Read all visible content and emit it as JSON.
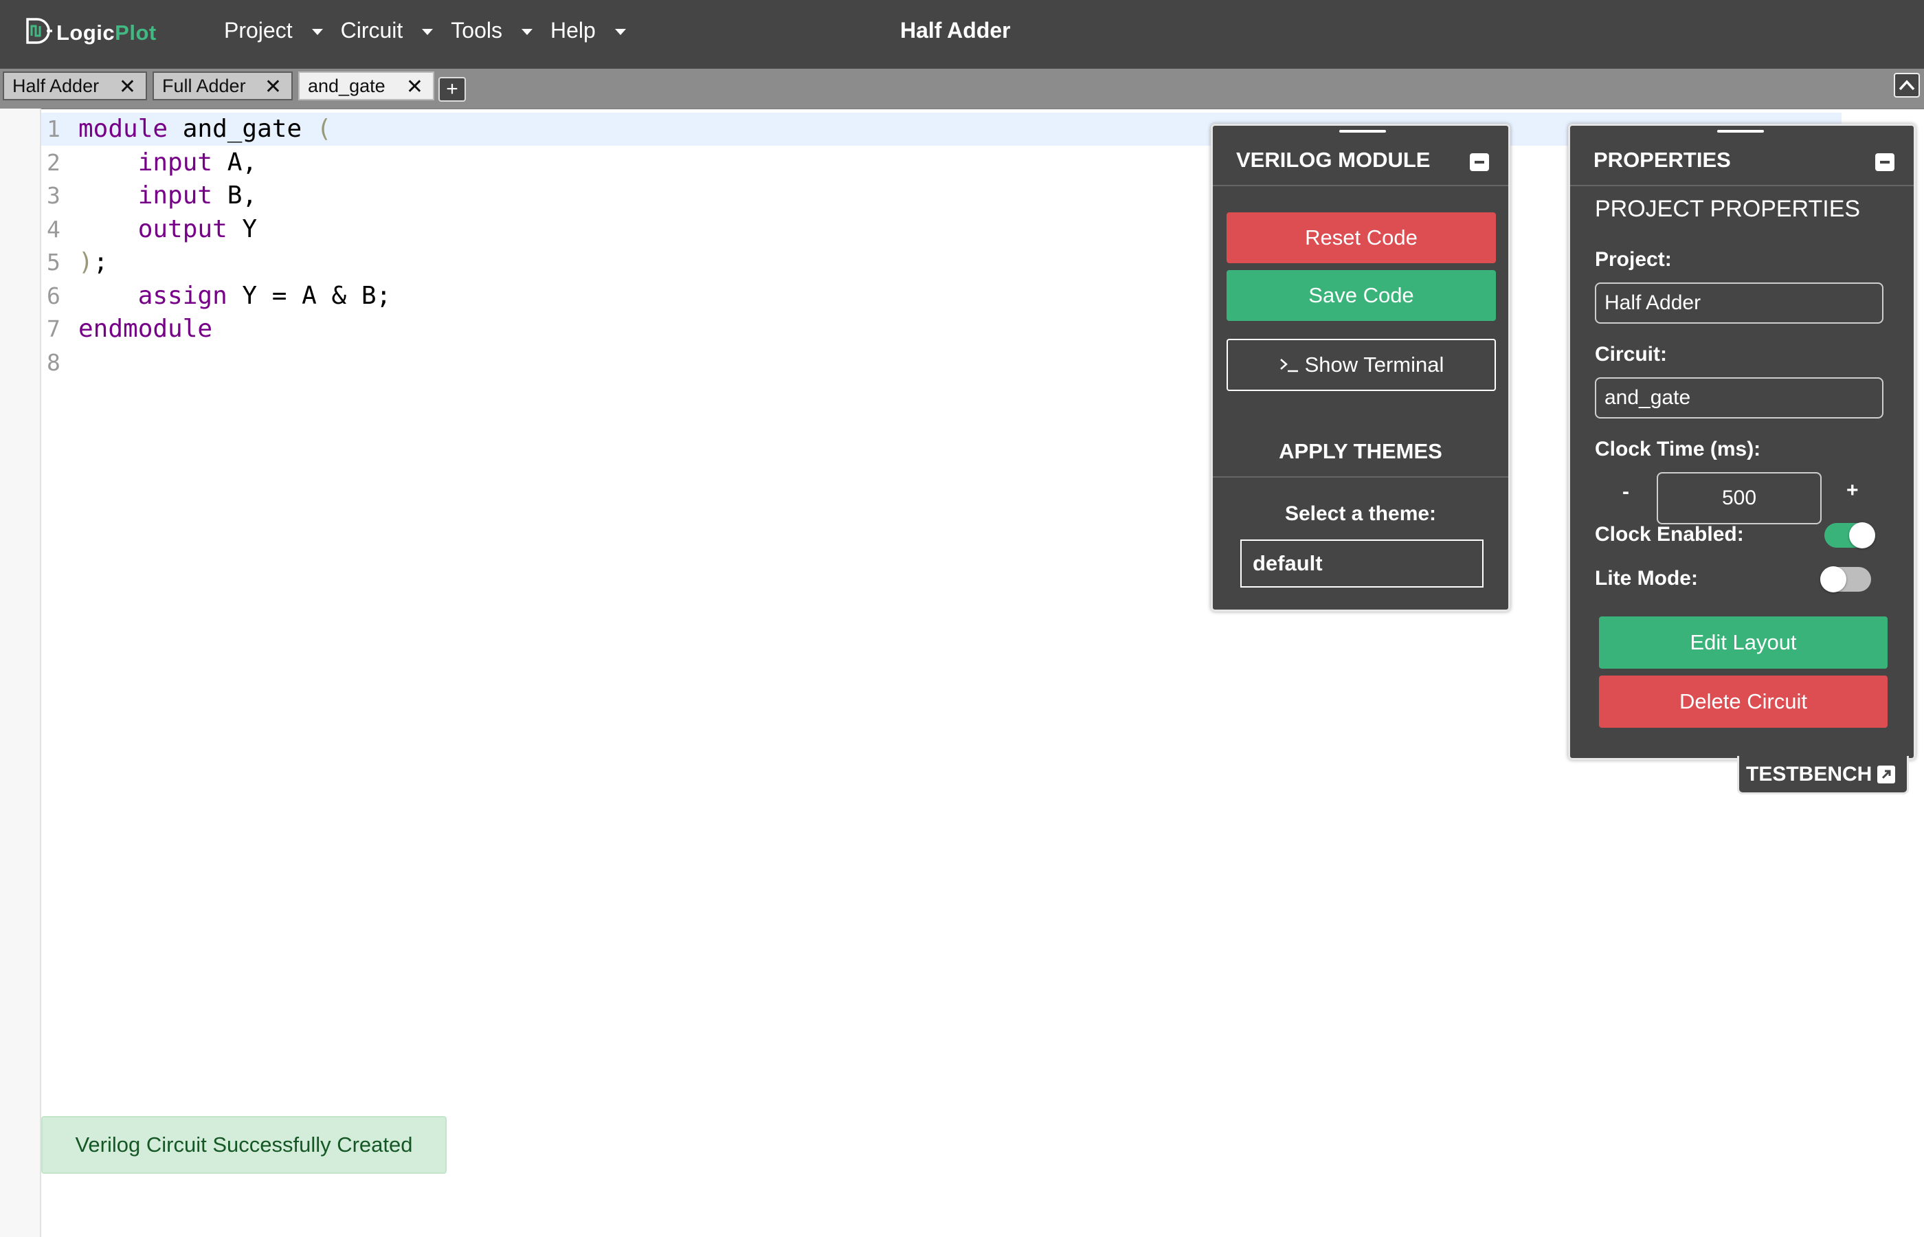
{
  "app": {
    "logo_text_primary": "Logic",
    "logo_text_accent": "Plot",
    "project_title": "Half Adder"
  },
  "menu": [
    {
      "label": "Project"
    },
    {
      "label": "Circuit"
    },
    {
      "label": "Tools"
    },
    {
      "label": "Help"
    }
  ],
  "tabs": [
    {
      "label": "Half Adder",
      "active": false
    },
    {
      "label": "Full Adder",
      "active": false
    },
    {
      "label": "and_gate",
      "active": true
    }
  ],
  "tab_close_glyph": "✕",
  "add_tab_glyph": "+",
  "editor": {
    "lines": [
      {
        "number": "1",
        "current": true,
        "tokens": [
          {
            "text": "module",
            "kw": true
          },
          {
            "text": " and_gate "
          },
          {
            "text": "(",
            "paren": true
          }
        ]
      },
      {
        "number": "2",
        "tokens": [
          {
            "text": "    "
          },
          {
            "text": "input",
            "kw": true
          },
          {
            "text": " A,"
          }
        ]
      },
      {
        "number": "3",
        "tokens": [
          {
            "text": "    "
          },
          {
            "text": "input",
            "kw": true
          },
          {
            "text": " B,"
          }
        ]
      },
      {
        "number": "4",
        "tokens": [
          {
            "text": "    "
          },
          {
            "text": "output",
            "kw": true
          },
          {
            "text": " Y"
          }
        ]
      },
      {
        "number": "5",
        "tokens": [
          {
            "text": ")",
            "paren": true
          },
          {
            "text": ";"
          }
        ]
      },
      {
        "number": "6",
        "tokens": [
          {
            "text": "    "
          },
          {
            "text": "assign",
            "kw": true
          },
          {
            "text": " Y = A & B;"
          }
        ]
      },
      {
        "number": "7",
        "tokens": [
          {
            "text": "endmodule",
            "kw": true
          }
        ]
      },
      {
        "number": "8",
        "tokens": []
      }
    ]
  },
  "verilog_panel": {
    "title": "VERILOG MODULE",
    "reset_label": "Reset Code",
    "save_label": "Save Code",
    "terminal_label": "Show Terminal",
    "themes_title": "APPLY THEMES",
    "select_theme_label": "Select a theme:",
    "theme_value": "default"
  },
  "properties_panel": {
    "title": "PROPERTIES",
    "section_title": "PROJECT PROPERTIES",
    "project_label": "Project:",
    "project_value": "Half Adder",
    "circuit_label": "Circuit:",
    "circuit_value": "and_gate",
    "clock_time_label": "Clock Time (ms):",
    "clock_minus": "-",
    "clock_value": "500",
    "clock_plus": "+",
    "clock_enabled_label": "Clock Enabled:",
    "clock_enabled": true,
    "lite_mode_label": "Lite Mode:",
    "lite_mode": false,
    "edit_layout_label": "Edit Layout",
    "delete_circuit_label": "Delete Circuit"
  },
  "testbench_label": "TESTBENCH",
  "toast_message": "Verilog Circuit Successfully Created",
  "colors": {
    "nav_bg": "#454545",
    "accent_green": "#42b983",
    "button_red": "#dc4e52",
    "button_green": "#3ab37a",
    "toast_bg": "#d4edda",
    "toast_text": "#155724"
  }
}
